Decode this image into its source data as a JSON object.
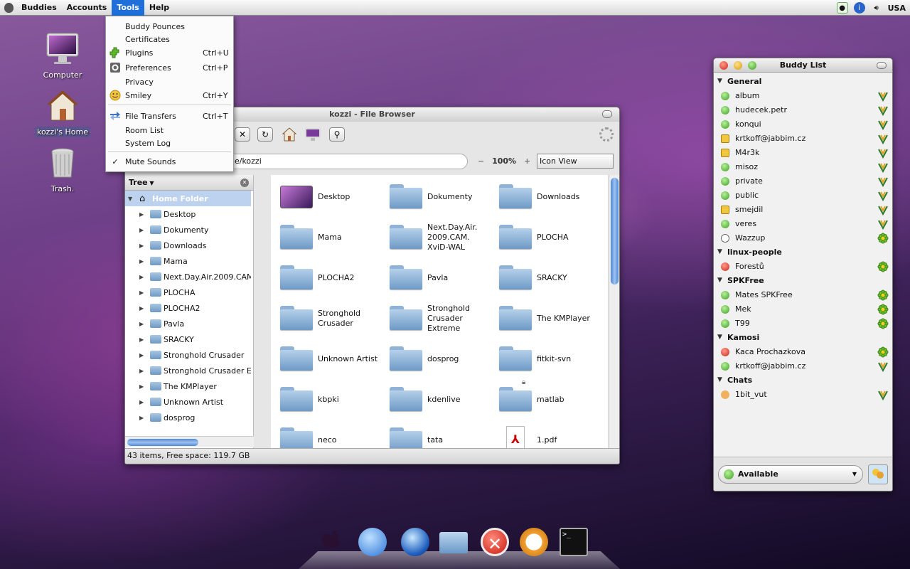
{
  "menubar": {
    "items": [
      "Buddies",
      "Accounts",
      "Tools",
      "Help"
    ],
    "active": "Tools",
    "tray_locale": "USA"
  },
  "tools_menu": {
    "items": [
      {
        "label": "Buddy Pounces",
        "shortcut": "",
        "icon": ""
      },
      {
        "label": "Certificates",
        "shortcut": "",
        "icon": ""
      },
      {
        "label": "Plugins",
        "shortcut": "Ctrl+U",
        "icon": "plugin-icon"
      },
      {
        "label": "Preferences",
        "shortcut": "Ctrl+P",
        "icon": "preferences-icon"
      },
      {
        "label": "Privacy",
        "shortcut": "",
        "icon": ""
      },
      {
        "label": "Smiley",
        "shortcut": "Ctrl+Y",
        "icon": "smiley-icon"
      },
      {
        "label": "File Transfers",
        "shortcut": "Ctrl+T",
        "icon": "file-transfer-icon"
      },
      {
        "label": "Room List",
        "shortcut": "",
        "icon": ""
      },
      {
        "label": "System Log",
        "shortcut": "",
        "icon": ""
      },
      {
        "label": "Mute Sounds",
        "shortcut": "",
        "icon": "checkmark-icon",
        "checked": true
      }
    ]
  },
  "desktop_icons": [
    {
      "label": "Computer",
      "icon": "computer-icon"
    },
    {
      "label": "kozzi's Home",
      "icon": "home-icon"
    },
    {
      "label": "Trash.",
      "icon": "trash-icon"
    }
  ],
  "file_browser": {
    "title": "kozzi - File Browser",
    "path": "ne/kozzi",
    "zoom": "100%",
    "zoom_minus": "−",
    "zoom_plus": "+",
    "view_mode": "Icon View",
    "tree_label": "Tree",
    "tree_root": "Home Folder",
    "tree_items": [
      "Desktop",
      "Dokumenty",
      "Downloads",
      "Mama",
      "Next.Day.Air.2009.CAM",
      "PLOCHA",
      "PLOCHA2",
      "Pavla",
      "SRACKY",
      "Stronghold Crusader",
      "Stronghold Crusader E",
      "The KMPlayer",
      "Unknown Artist",
      "dosprog"
    ],
    "icon_items": [
      "Desktop",
      "Dokumenty",
      "Downloads",
      "Mama",
      "Next.Day.Air.\n2009.CAM.\nXviD-WAL",
      "PLOCHA",
      "PLOCHA2",
      "Pavla",
      "SRACKY",
      "Stronghold\nCrusader",
      "Stronghold\nCrusader\nExtreme",
      "The KMPlayer",
      "Unknown Artist",
      "dosprog",
      "fitkit-svn",
      "kbpki",
      "kdenlive",
      "matlab",
      "neco",
      "tata",
      "1.pdf"
    ],
    "status": "43 items, Free space: 119.7 GB"
  },
  "buddy_list": {
    "title": "Buddy List",
    "groups": [
      {
        "name": "General",
        "buddies": [
          {
            "name": "album",
            "status": "available",
            "proto": "jabber"
          },
          {
            "name": "hudecek.petr",
            "status": "available",
            "proto": "jabber"
          },
          {
            "name": "konqui",
            "status": "available",
            "proto": "jabber"
          },
          {
            "name": "krtkoff@jabbim.cz",
            "status": "note",
            "proto": "jabber"
          },
          {
            "name": "M4r3k",
            "status": "note",
            "proto": "jabber"
          },
          {
            "name": "misoz",
            "status": "available",
            "proto": "jabber"
          },
          {
            "name": "private",
            "status": "available",
            "proto": "jabber"
          },
          {
            "name": "public",
            "status": "available",
            "proto": "jabber"
          },
          {
            "name": "smejdil",
            "status": "note",
            "proto": "jabber"
          },
          {
            "name": "veres",
            "status": "available",
            "proto": "jabber"
          },
          {
            "name": "Wazzup",
            "status": "idle",
            "proto": "icq"
          }
        ]
      },
      {
        "name": "linux-people",
        "buddies": [
          {
            "name": "Forestů",
            "status": "busy",
            "proto": "icq"
          }
        ]
      },
      {
        "name": "SPKFree",
        "buddies": [
          {
            "name": "Mates SPKFree",
            "status": "available",
            "proto": "icq"
          },
          {
            "name": "Mek",
            "status": "available",
            "proto": "icq"
          },
          {
            "name": "T99",
            "status": "available",
            "proto": "icq"
          }
        ]
      },
      {
        "name": "Kamosi",
        "buddies": [
          {
            "name": "Kaca Prochazkova",
            "status": "busy",
            "proto": "icq"
          },
          {
            "name": "krtkoff@jabbim.cz",
            "status": "available",
            "proto": "jabber"
          }
        ]
      },
      {
        "name": "Chats",
        "buddies": [
          {
            "name": "1bit_vut",
            "status": "chat",
            "proto": "jabber"
          }
        ]
      }
    ],
    "status_selector": "Available"
  },
  "colors": {
    "accent": "#1e6fd9",
    "available": "#4caf3a",
    "busy": "#d23a2e",
    "note": "#e0b020"
  }
}
